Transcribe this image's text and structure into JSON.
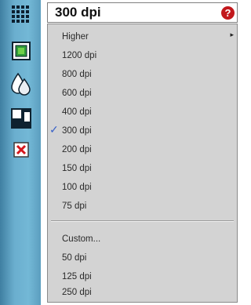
{
  "field": {
    "value": "300 dpi",
    "help_glyph": "?"
  },
  "menu": {
    "items": [
      {
        "label": "Higher",
        "submenu": true
      },
      {
        "label": "1200 dpi"
      },
      {
        "label": "800 dpi"
      },
      {
        "label": "600 dpi"
      },
      {
        "label": "400 dpi"
      },
      {
        "label": "300 dpi",
        "checked": true
      },
      {
        "label": "200 dpi"
      },
      {
        "label": "150 dpi"
      },
      {
        "label": "100 dpi"
      },
      {
        "label": "75 dpi"
      },
      {
        "label": "Custom..."
      },
      {
        "label": "50 dpi"
      },
      {
        "label": "125 dpi"
      },
      {
        "label": "250 dpi"
      }
    ],
    "check_glyph": "✓",
    "submenu_glyph": "▸"
  },
  "toolbar": {
    "icons": [
      "grip-icon",
      "color-box-icon",
      "ink-drops-icon",
      "fill-icon",
      "remove-icon"
    ]
  },
  "colors": {
    "sidebar": "#6aaece",
    "menu_bg": "#d3d3d3",
    "check": "#3a62c8",
    "help": "#c2181c"
  }
}
